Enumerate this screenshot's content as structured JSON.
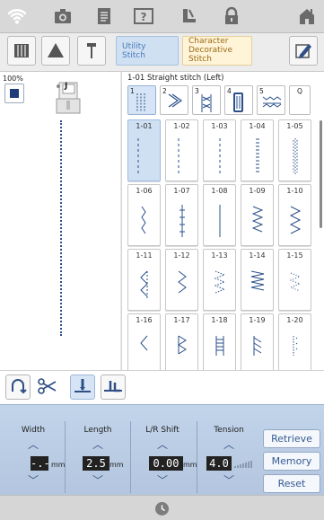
{
  "top_icons": [
    "wifi-icon",
    "camera-icon",
    "document-icon",
    "help-icon",
    "thread-icon",
    "lock-icon",
    "home-icon"
  ],
  "mode_tabs": {
    "utility": "Utility\nStitch",
    "character": "Character\nDecorative\nStitch"
  },
  "left": {
    "zoom": "100%",
    "foot": "J"
  },
  "stitch": {
    "title": "1-01 Straight stitch (Left)",
    "categories": [
      "1",
      "2",
      "3",
      "4",
      "5",
      "Q"
    ],
    "cells": [
      "1-01",
      "1-02",
      "1-03",
      "1-04",
      "1-05",
      "1-06",
      "1-07",
      "1-08",
      "1-09",
      "1-10",
      "1-11",
      "1-12",
      "1-13",
      "1-14",
      "1-15",
      "1-16",
      "1-17",
      "1-18",
      "1-19",
      "1-20"
    ],
    "selected": "1-01"
  },
  "controls": {
    "width": {
      "label": "Width",
      "value": "-.-",
      "unit": "mm"
    },
    "length": {
      "label": "Length",
      "value": "2.5",
      "unit": "mm"
    },
    "lr_shift": {
      "label": "L/R Shift",
      "value": "0.00",
      "unit": "mm"
    },
    "tension": {
      "label": "Tension",
      "value": "4.0"
    }
  },
  "buttons": {
    "retrieve": "Retrieve",
    "memory": "Memory",
    "reset": "Reset"
  },
  "colors": {
    "accent": "#cfe0f3",
    "stitch": "#2a4f8a",
    "panel": "#b9cbe3"
  }
}
